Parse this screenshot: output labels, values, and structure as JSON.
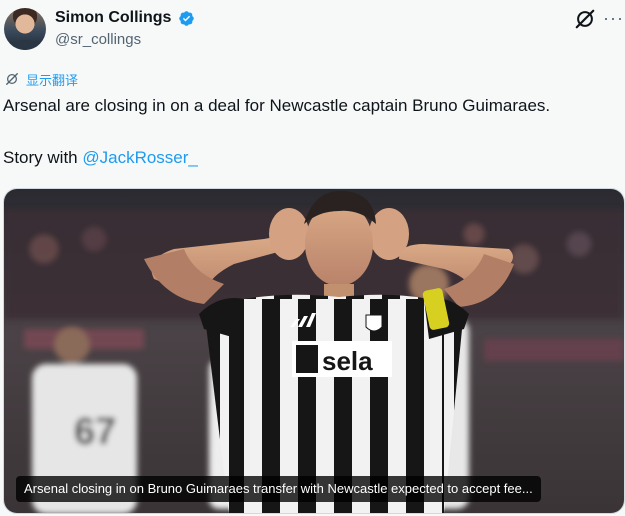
{
  "author": {
    "name": "Simon Collings",
    "handle": "@sr_collings"
  },
  "icons": {
    "verified": "verified-badge-icon",
    "grok": "grok-icon",
    "more": "more-horizontal-icon",
    "translate": "translate-icon"
  },
  "colors": {
    "accent": "#1d9bf0",
    "text": "#0f1419",
    "muted": "#536471",
    "background": "#f7f9f9"
  },
  "translate_label": "显示翻译",
  "tweet": {
    "line1": "Arsenal are closing in on a deal for Newcastle captain Bruno Guimaraes.",
    "line2_prefix": "Story with ",
    "mention": "@JackRosser_"
  },
  "media": {
    "shirt_sponsor": "sela",
    "back_number": "67",
    "caption": "Arsenal closing in on Bruno Guimaraes transfer with Newcastle expected to accept fee..."
  }
}
